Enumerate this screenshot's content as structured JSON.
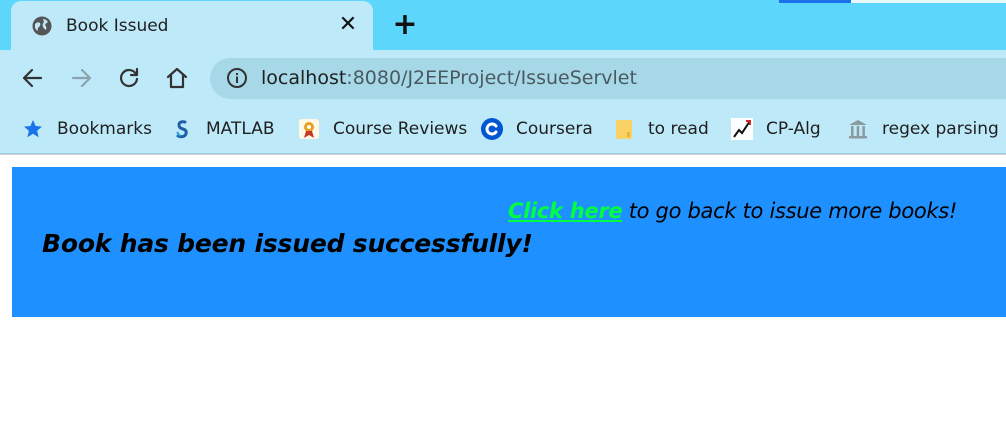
{
  "browser": {
    "tab": {
      "title": "Book Issued",
      "icon": "globe-icon"
    },
    "address": {
      "host": "localhost",
      "path": ":8080/J2EEProject/IssueServlet"
    },
    "bookmarks": [
      {
        "label": "Bookmarks",
        "icon": "star-icon"
      },
      {
        "label": "MATLAB",
        "icon": "matlab-icon"
      },
      {
        "label": "Course Reviews",
        "icon": "course-reviews-icon"
      },
      {
        "label": "Coursera",
        "icon": "coursera-icon"
      },
      {
        "label": "to read",
        "icon": "folder-icon"
      },
      {
        "label": "CP-Alg",
        "icon": "chart-icon"
      },
      {
        "label": "regex parsing",
        "icon": "building-icon"
      }
    ]
  },
  "page": {
    "message": "Book has been issued successfully!",
    "back_link": "Click here",
    "back_text": " to go back to issue more books!"
  },
  "colors": {
    "tabstrip": "#5dd6fc",
    "toolbar": "#bde9f9",
    "banner": "#1e90ff",
    "link": "#00ff40"
  }
}
